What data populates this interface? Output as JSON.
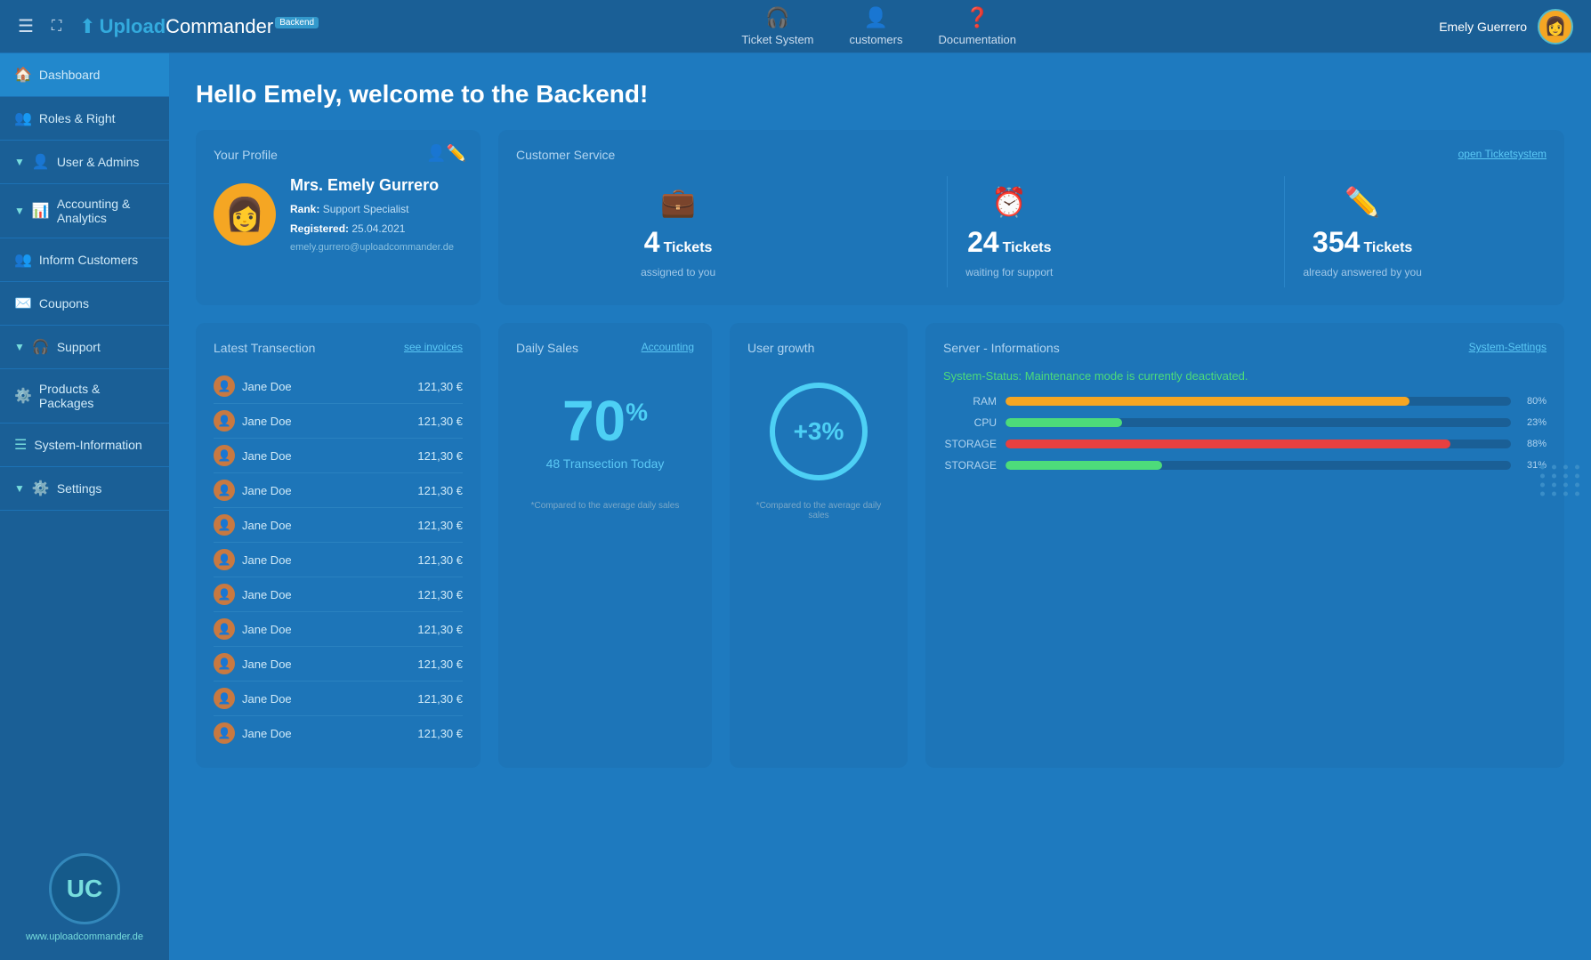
{
  "app": {
    "logo_upload": "Upload",
    "logo_commander": "Commander",
    "logo_backend": "Backend",
    "title": "UploadCommander"
  },
  "topbar": {
    "nav": [
      {
        "id": "ticket-system",
        "label": "Ticket System",
        "icon": "🎧"
      },
      {
        "id": "customers",
        "label": "customers",
        "icon": "👤"
      },
      {
        "id": "documentation",
        "label": "Documentation",
        "icon": "❓"
      }
    ],
    "user_name": "Emely Guerrero"
  },
  "sidebar": {
    "items": [
      {
        "id": "dashboard",
        "label": "Dashboard",
        "icon": "🏠",
        "active": true,
        "has_arrow": false
      },
      {
        "id": "roles-right",
        "label": "Roles & Right",
        "icon": "👥",
        "active": false,
        "has_arrow": false
      },
      {
        "id": "user-admins",
        "label": "User & Admins",
        "icon": "👤",
        "active": false,
        "has_arrow": true
      },
      {
        "id": "accounting-analytics",
        "label": "Accounting & Analytics",
        "icon": "📊",
        "active": false,
        "has_arrow": true
      },
      {
        "id": "inform-customers",
        "label": "Inform Customers",
        "icon": "👥",
        "active": false,
        "has_arrow": false
      },
      {
        "id": "coupons",
        "label": "Coupons",
        "icon": "✉️",
        "active": false,
        "has_arrow": false
      },
      {
        "id": "support",
        "label": "Support",
        "icon": "🎧",
        "active": false,
        "has_arrow": true
      },
      {
        "id": "products-packages",
        "label": "Products & Packages",
        "icon": "⚙️",
        "active": false,
        "has_arrow": false
      },
      {
        "id": "system-information",
        "label": "System-Information",
        "icon": "☰",
        "active": false,
        "has_arrow": false
      },
      {
        "id": "settings",
        "label": "Settings",
        "icon": "⚙️",
        "active": false,
        "has_arrow": true
      }
    ],
    "logo_initials": "UC",
    "website": "www.uploadcommander.de"
  },
  "page": {
    "greeting": "Hello Emely, welcome to the Backend!"
  },
  "profile_card": {
    "title": "Your Profile",
    "name": "Mrs. Emely Gurrero",
    "rank_label": "Rank:",
    "rank_value": "Support Specialist",
    "registered_label": "Registered:",
    "registered_value": "25.04.2021",
    "email": "emely.gurrero@uploadcommander.de"
  },
  "customer_service": {
    "title": "Customer Service",
    "link": "open Ticketsystem",
    "stats": [
      {
        "number": "4",
        "tickets_label": "Tickets",
        "description": "assigned to you",
        "icon": "💼"
      },
      {
        "number": "24",
        "tickets_label": "Tickets",
        "description": "waiting for support",
        "icon": "⏰"
      },
      {
        "number": "354",
        "tickets_label": "Tickets",
        "description": "already answered by you",
        "icon": "✏️"
      }
    ]
  },
  "transactions": {
    "title": "Latest Transection",
    "link": "see invoices",
    "items": [
      {
        "name": "Jane Doe",
        "amount": "121,30 €"
      },
      {
        "name": "Jane Doe",
        "amount": "121,30 €"
      },
      {
        "name": "Jane Doe",
        "amount": "121,30 €"
      },
      {
        "name": "Jane Doe",
        "amount": "121,30 €"
      },
      {
        "name": "Jane Doe",
        "amount": "121,30 €"
      },
      {
        "name": "Jane Doe",
        "amount": "121,30 €"
      },
      {
        "name": "Jane Doe",
        "amount": "121,30 €"
      },
      {
        "name": "Jane Doe",
        "amount": "121,30 €"
      },
      {
        "name": "Jane Doe",
        "amount": "121,30 €"
      },
      {
        "name": "Jane Doe",
        "amount": "121,30 €"
      },
      {
        "name": "Jane Doe",
        "amount": "121,30 €"
      }
    ]
  },
  "daily_sales": {
    "title": "Daily Sales",
    "link": "Accounting",
    "percent": "70",
    "percent_symbol": "%",
    "transactions_label": "48 Transection Today",
    "note": "*Compared to the average daily sales"
  },
  "user_growth": {
    "title": "User growth",
    "value": "+3%",
    "note": "*Compared to the average daily sales"
  },
  "server": {
    "title": "Server - Informations",
    "link": "System-Settings",
    "status_label": "System-Status:",
    "status_value": "Maintenance mode is currently deactivated.",
    "bars": [
      {
        "label": "RAM",
        "percent": 80,
        "color": "#f5a623"
      },
      {
        "label": "CPU",
        "percent": 23,
        "color": "#4ddb7a"
      },
      {
        "label": "STORAGE",
        "percent": 88,
        "color": "#e84040"
      },
      {
        "label": "STORAGE",
        "percent": 31,
        "color": "#4ddb7a"
      }
    ]
  }
}
